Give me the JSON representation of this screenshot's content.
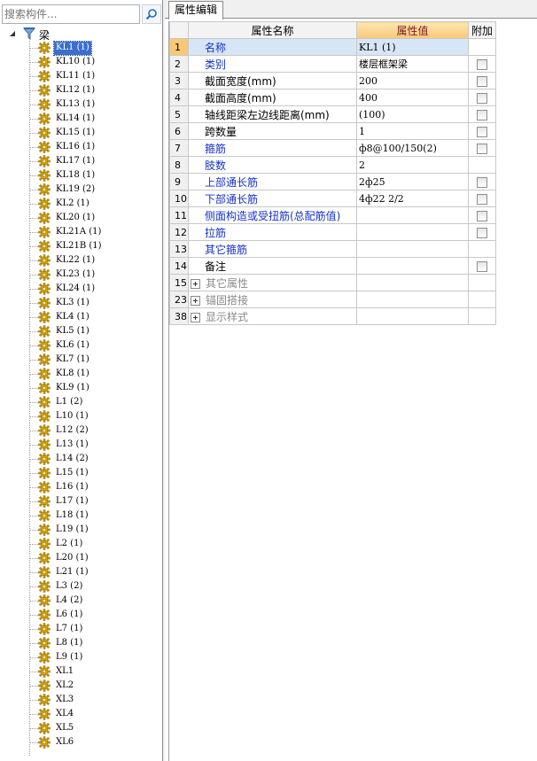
{
  "search": {
    "placeholder": "搜索构件..."
  },
  "tree": {
    "root_label": "梁",
    "items": [
      {
        "label": "KL1 (1)",
        "selected": true
      },
      {
        "label": "KL10 (1)"
      },
      {
        "label": "KL11 (1)"
      },
      {
        "label": "KL12 (1)"
      },
      {
        "label": "KL13 (1)"
      },
      {
        "label": "KL14 (1)"
      },
      {
        "label": "KL15 (1)"
      },
      {
        "label": "KL16 (1)"
      },
      {
        "label": "KL17 (1)"
      },
      {
        "label": "KL18 (1)"
      },
      {
        "label": "KL19 (2)"
      },
      {
        "label": "KL2 (1)"
      },
      {
        "label": "KL20 (1)"
      },
      {
        "label": "KL21A (1)"
      },
      {
        "label": "KL21B (1)"
      },
      {
        "label": "KL22 (1)"
      },
      {
        "label": "KL23 (1)"
      },
      {
        "label": "KL24 (1)"
      },
      {
        "label": "KL3 (1)"
      },
      {
        "label": "KL4 (1)"
      },
      {
        "label": "KL5 (1)"
      },
      {
        "label": "KL6 (1)"
      },
      {
        "label": "KL7 (1)"
      },
      {
        "label": "KL8 (1)"
      },
      {
        "label": "KL9 (1)"
      },
      {
        "label": "L1 (2)"
      },
      {
        "label": "L10 (1)"
      },
      {
        "label": "L12 (2)"
      },
      {
        "label": "L13 (1)"
      },
      {
        "label": "L14 (2)"
      },
      {
        "label": "L15 (1)"
      },
      {
        "label": "L16 (1)"
      },
      {
        "label": "L17 (1)"
      },
      {
        "label": "L18 (1)"
      },
      {
        "label": "L19 (1)"
      },
      {
        "label": "L2 (1)"
      },
      {
        "label": "L20 (1)"
      },
      {
        "label": "L21 (1)"
      },
      {
        "label": "L3 (2)"
      },
      {
        "label": "L4 (2)"
      },
      {
        "label": "L6 (1)"
      },
      {
        "label": "L7 (1)"
      },
      {
        "label": "L8 (1)"
      },
      {
        "label": "L9 (1)"
      },
      {
        "label": "XL1"
      },
      {
        "label": "XL2"
      },
      {
        "label": "XL3"
      },
      {
        "label": "XL4"
      },
      {
        "label": "XL5"
      },
      {
        "label": "XL6"
      }
    ]
  },
  "tab": {
    "label": "属性编辑"
  },
  "grid": {
    "headers": {
      "name": "属性名称",
      "value": "属性值",
      "extra": "附加"
    },
    "rows": [
      {
        "num": "1",
        "name": "名称",
        "color": "blue",
        "value": "KL1 (1)",
        "checkbox": false,
        "selected": true
      },
      {
        "num": "2",
        "name": "类别",
        "color": "blue",
        "value": "楼层框架梁",
        "checkbox": true
      },
      {
        "num": "3",
        "name": "截面宽度(mm)",
        "color": "black",
        "value": "200",
        "checkbox": true
      },
      {
        "num": "4",
        "name": "截面高度(mm)",
        "color": "black",
        "value": "400",
        "checkbox": true
      },
      {
        "num": "5",
        "name": "轴线距梁左边线距离(mm)",
        "color": "black",
        "value": "(100)",
        "checkbox": true
      },
      {
        "num": "6",
        "name": "跨数量",
        "color": "black",
        "value": "1",
        "checkbox": true
      },
      {
        "num": "7",
        "name": "箍筋",
        "color": "blue",
        "value": "ф8@100/150(2)",
        "checkbox": true
      },
      {
        "num": "8",
        "name": "肢数",
        "color": "blue",
        "value": "2",
        "checkbox": false
      },
      {
        "num": "9",
        "name": "上部通长筋",
        "color": "blue",
        "value": "2ф25",
        "checkbox": true
      },
      {
        "num": "10",
        "name": "下部通长筋",
        "color": "blue",
        "value": "4ф22 2/2",
        "checkbox": true
      },
      {
        "num": "11",
        "name": "侧面构造或受扭筋(总配筋值)",
        "color": "blue",
        "value": "",
        "checkbox": true
      },
      {
        "num": "12",
        "name": "拉筋",
        "color": "blue",
        "value": "",
        "checkbox": true
      },
      {
        "num": "13",
        "name": "其它箍筋",
        "color": "blue",
        "value": "",
        "checkbox": false
      },
      {
        "num": "14",
        "name": "备注",
        "color": "black",
        "value": "",
        "checkbox": true
      },
      {
        "num": "15",
        "name": "其它属性",
        "color": "grey",
        "value": "",
        "checkbox": false,
        "group": true
      },
      {
        "num": "23",
        "name": "锚固搭接",
        "color": "grey",
        "value": "",
        "checkbox": false,
        "group": true
      },
      {
        "num": "38",
        "name": "显示样式",
        "color": "grey",
        "value": "",
        "checkbox": false,
        "group": true
      }
    ]
  }
}
